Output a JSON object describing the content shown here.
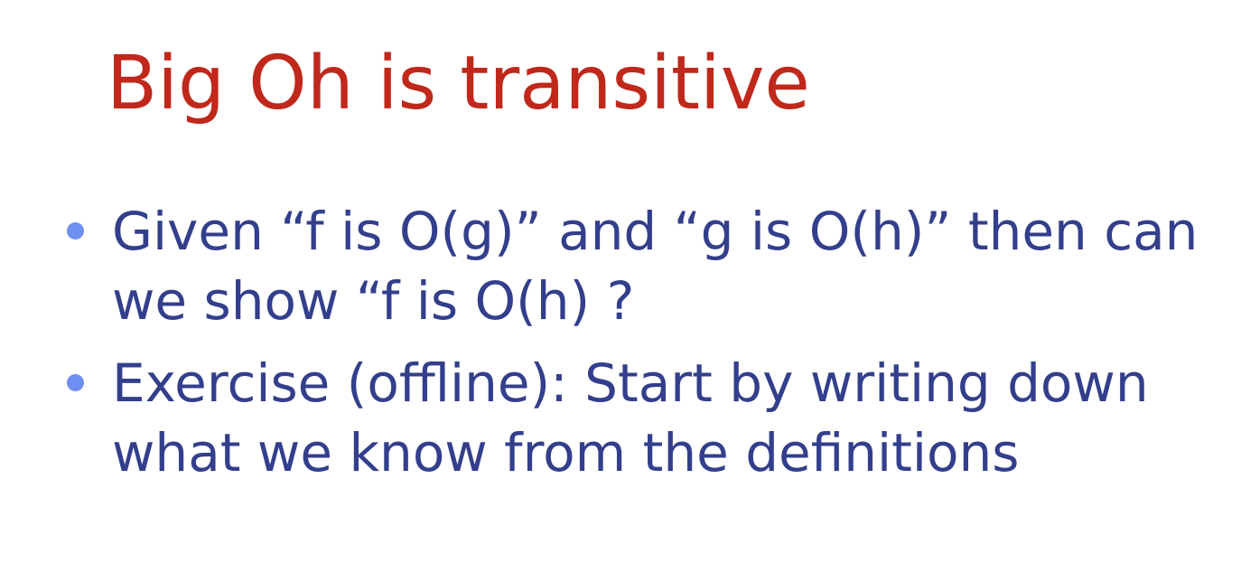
{
  "slide": {
    "title": "Big Oh is transitive",
    "bullets": [
      {
        "line1": "Given  “f is O(g)” and “g is O(h)” then can",
        "line2": "we show “f is O(h) ?"
      },
      {
        "line1": "Exercise (offline): Start by writing down",
        "line2": "what we know from the definitions"
      }
    ]
  },
  "colors": {
    "title": "#c0281b",
    "body": "#333f8c",
    "bullet": "#6f8ff0",
    "background": "#ffffff"
  },
  "icons": {
    "bullet": "bullet-dot-icon"
  }
}
